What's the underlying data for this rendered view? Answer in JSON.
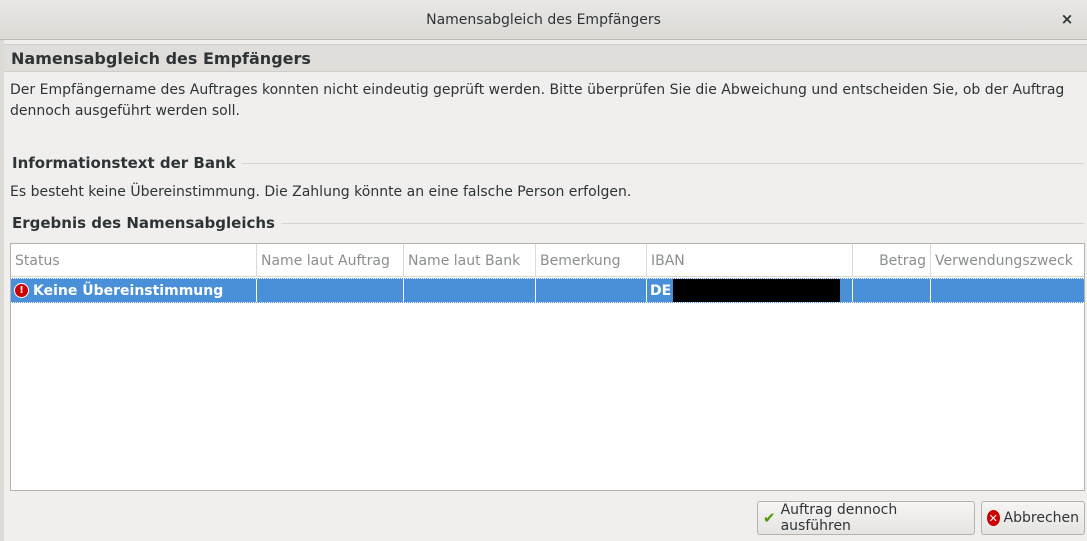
{
  "window": {
    "title": "Namensabgleich des Empfängers",
    "close_glyph": "×"
  },
  "header": {
    "title": "Namensabgleich des Empfängers"
  },
  "description": "Der Empfängername des Auftrages konnten nicht eindeutig geprüft werden. Bitte überprüfen Sie die Abweichung und entscheiden Sie, ob der Auftrag dennoch ausgeführt werden soll.",
  "bank_info": {
    "heading": "Informationstext der Bank",
    "text": "Es besteht keine Übereinstimmung. Die Zahlung könnte an eine falsche Person erfolgen."
  },
  "result": {
    "heading": "Ergebnis des Namensabgleichs",
    "columns": [
      "Status",
      "Name laut Auftrag",
      "Name laut Bank",
      "Bemerkung",
      "IBAN",
      "Betrag",
      "Verwendungszweck"
    ],
    "rows": [
      {
        "status": "Keine Übereinstimmung",
        "status_icon": "error-icon",
        "name_auftrag": "",
        "name_bank": "",
        "bemerkung": "",
        "iban": "DE",
        "betrag": "",
        "verwendungszweck": ""
      }
    ]
  },
  "buttons": {
    "execute_label": "Auftrag dennoch ausführen",
    "execute_icon": "checkmark-icon",
    "cancel_label": "Abbrechen",
    "cancel_icon": "cancel-icon"
  },
  "colors": {
    "selection": "#4a90d9",
    "error": "#cc0000",
    "ok": "#4e9a06"
  }
}
